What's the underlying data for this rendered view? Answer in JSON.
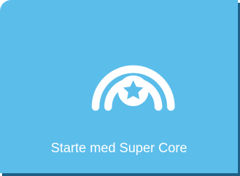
{
  "card": {
    "label": "Starte med Super Core",
    "icon": "star-rainbow-icon",
    "background_color": "#5bbdea",
    "shadow_color": "#1f5f86",
    "text_color": "#ffffff"
  }
}
